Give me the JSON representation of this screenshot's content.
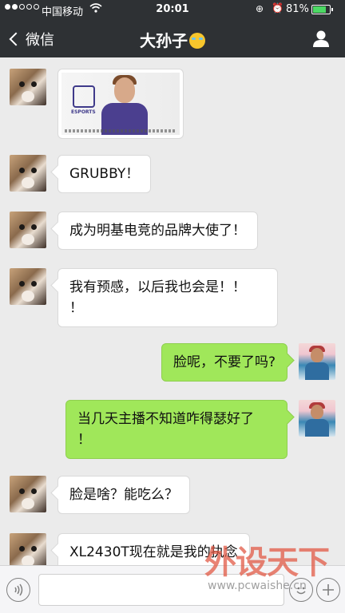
{
  "status_bar": {
    "carrier": "中国移动",
    "time": "20:01",
    "battery_text": "81%",
    "battery_level": 0.81
  },
  "nav": {
    "back_label": "微信",
    "title": "大孙子"
  },
  "messages": [
    {
      "side": "left",
      "type": "image",
      "image_caption_text": "ESPORTS"
    },
    {
      "side": "left",
      "type": "text",
      "text": "GRUBBY！"
    },
    {
      "side": "left",
      "type": "text",
      "text": "成为明基电竞的品牌大使了！"
    },
    {
      "side": "left",
      "type": "text",
      "text": "我有预感，以后我也会是！！\n！"
    },
    {
      "side": "right",
      "type": "text",
      "text": "脸呢，不要了吗?"
    },
    {
      "side": "right",
      "type": "text",
      "text": "当几天主播不知道咋得瑟好了\n！"
    },
    {
      "side": "left",
      "type": "text",
      "text": "脸是啥？能吃么？"
    },
    {
      "side": "left",
      "type": "text",
      "text": "XL2430T现在就是我的执念"
    }
  ],
  "watermark": {
    "brand": "外设天下",
    "url": "www.pcwaishe.cn"
  },
  "icons": [
    "signal-dots-icon",
    "wifi-icon",
    "rotation-lock-icon",
    "alarm-icon",
    "battery-icon",
    "back-chevron-icon",
    "profile-icon",
    "voice-icon",
    "emoji-icon",
    "plus-icon"
  ]
}
